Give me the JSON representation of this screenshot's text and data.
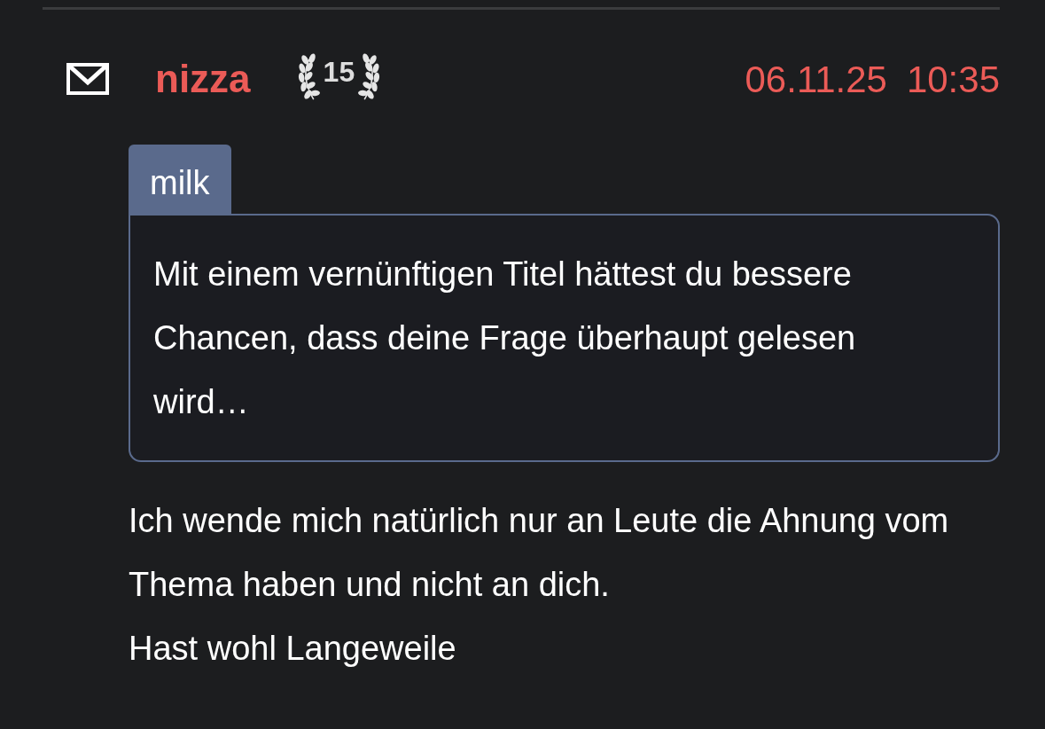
{
  "post": {
    "author": "nizza",
    "rank": "15",
    "date": "06.11.25",
    "time": "10:35",
    "quote": {
      "author": "milk",
      "text": "Mit einem vernünftigen Titel hättest du bessere Chancen, dass deine Frage überhaupt gelesen wird…"
    },
    "body": [
      "Ich wende mich natürlich nur an Leute die Ahnung vom Thema haben und nicht an dich.",
      "Hast wohl Langeweile"
    ]
  }
}
